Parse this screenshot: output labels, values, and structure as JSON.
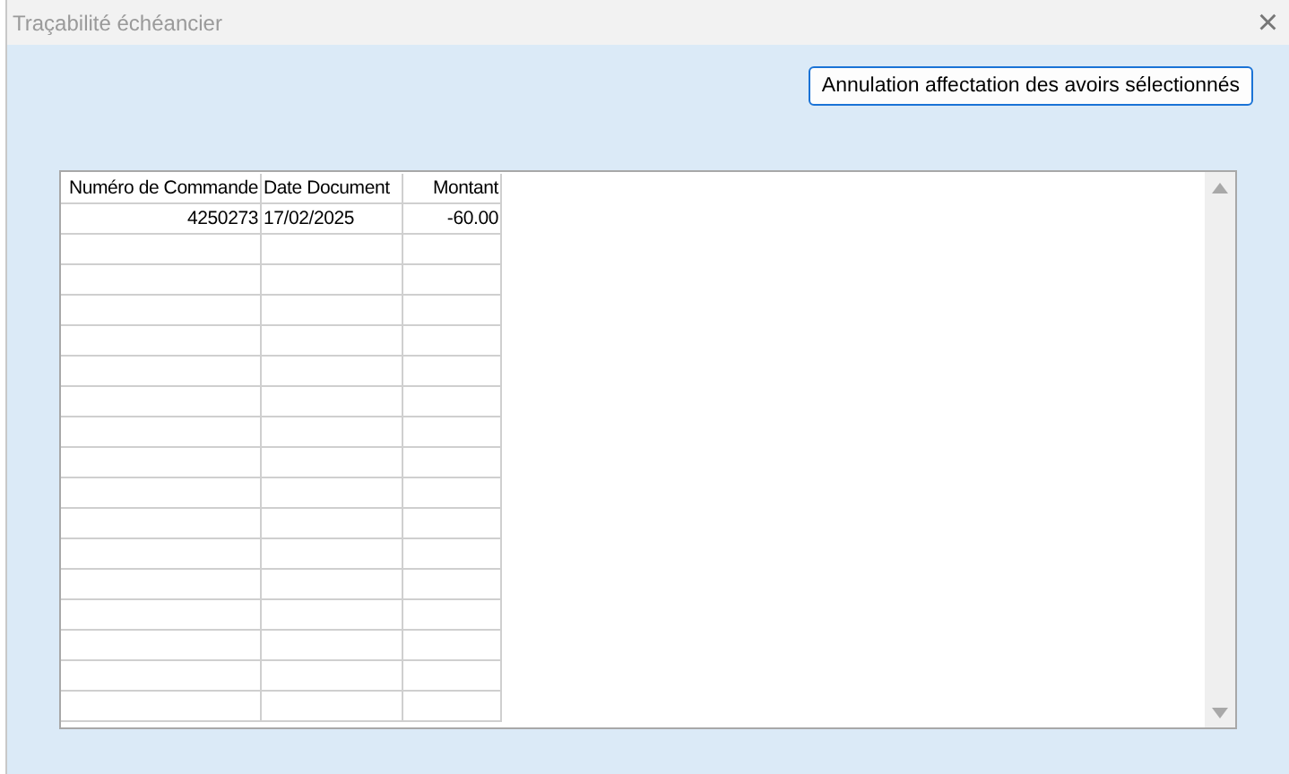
{
  "window": {
    "title": "Traçabilité échéancier",
    "close": "×"
  },
  "action_button": "Annulation affectation des avoirs sélectionnés",
  "table": {
    "columns": [
      {
        "label": "Numéro de Commande"
      },
      {
        "label": "Date Document"
      },
      {
        "label": "Montant"
      }
    ],
    "rows": [
      [
        "4250273",
        "17/02/2025",
        "-60.00"
      ]
    ]
  }
}
